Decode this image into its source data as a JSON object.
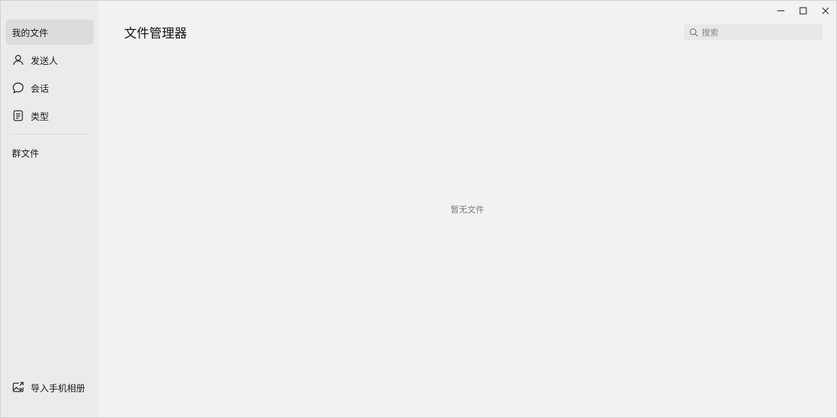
{
  "sidebar": {
    "items": [
      {
        "label": "我的文件",
        "icon": null,
        "active": true
      },
      {
        "label": "发送人",
        "icon": "person-icon"
      },
      {
        "label": "会话",
        "icon": "chat-bubble-icon"
      },
      {
        "label": "类型",
        "icon": "document-icon"
      }
    ],
    "group_files_label": "群文件",
    "import_label": "导入手机相册",
    "import_icon": "import-photo-icon"
  },
  "main": {
    "title": "文件管理器",
    "search": {
      "placeholder": "搜索",
      "value": "",
      "icon": "search-icon"
    },
    "empty_text": "暂无文件"
  },
  "window_controls": {
    "icons": [
      "minimize-icon",
      "maximize-icon",
      "close-icon"
    ]
  },
  "colors": {
    "background": "#f2f2f2",
    "sidebar_background": "#ebebeb",
    "active_item": "#dcdcdc"
  }
}
